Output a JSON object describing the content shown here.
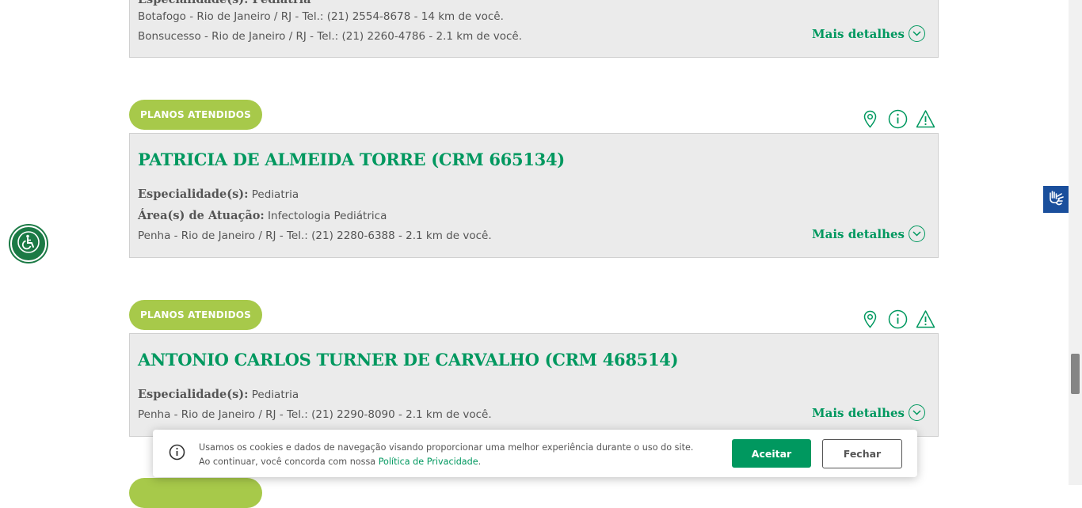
{
  "colors": {
    "brand_green": "#00985f",
    "pill_green": "#a7c94a",
    "card_bg": "#ebebeb",
    "libras_blue": "#1a4f9c"
  },
  "first_card": {
    "partial_heading": "Especialidade(s): Pediatria",
    "address_1": "Botafogo - Rio de Janeiro / RJ - Tel.: (21) 2554-8678 - 14 km de você.",
    "address_2": "Bonsucesso - Rio de Janeiro / RJ - Tel.: (21) 2260-4786 - 2.1 km de você.",
    "more_label": "Mais detalhes"
  },
  "doctors": [
    {
      "plans_label": "PLANOS ATENDIDOS",
      "name": "PATRICIA DE ALMEIDA TORRE (CRM 665134)",
      "specialty_label": "Especialidade(s):",
      "specialty": "Pediatria",
      "area_label": "Área(s) de Atuação:",
      "area": "Infectologia Pediátrica",
      "address": "Penha - Rio de Janeiro / RJ - Tel.: (21) 2280-6388 - 2.1 km de você.",
      "more_label": "Mais detalhes"
    },
    {
      "plans_label": "PLANOS ATENDIDOS",
      "name": "ANTONIO CARLOS TURNER DE CARVALHO (CRM 468514)",
      "specialty_label": "Especialidade(s):",
      "specialty": "Pediatria",
      "address": "Penha - Rio de Janeiro / RJ - Tel.: (21) 2290-8090 - 2.1 km de você.",
      "more_label": "Mais detalhes"
    }
  ],
  "card_icons": [
    "map-pin-icon",
    "info-icon",
    "warning-icon"
  ],
  "cookie_banner": {
    "text_1": "Usamos os cookies e dados de navegação visando proporcionar uma melhor experiência durante o uso do site. Ao continuar, você concorda com nossa ",
    "link": "Política de Privacidade",
    "text_end": ".",
    "accept_label": "Aceitar",
    "close_label": "Fechar"
  }
}
